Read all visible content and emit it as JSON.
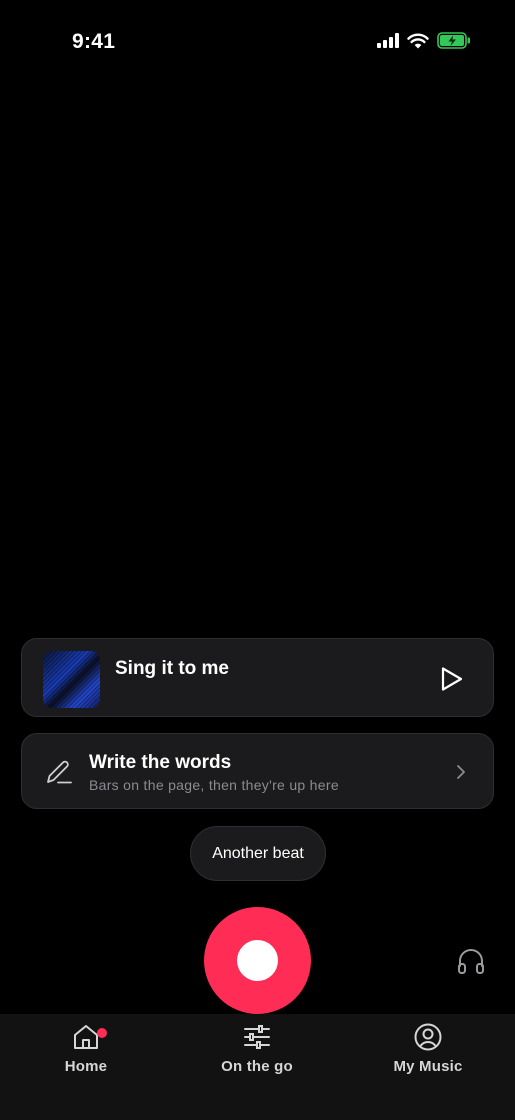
{
  "status_bar": {
    "time": "9:41"
  },
  "player": {
    "title": "Sing it to me",
    "art_icon": "album-art",
    "play_icon": "play-icon"
  },
  "lyrics": {
    "title": "Write the words",
    "subtitle": "Bars on the page, then they're up here",
    "icon": "pencil-icon"
  },
  "beat_button": {
    "label": "Another beat"
  },
  "record": {
    "icon": "record-icon",
    "accent": "#ff2d55"
  },
  "tabs": [
    {
      "label": "Home",
      "icon": "home-icon",
      "has_notification": true
    },
    {
      "label": "On the go",
      "icon": "sliders-icon",
      "has_notification": false
    },
    {
      "label": "My Music",
      "icon": "profile-icon",
      "has_notification": false
    }
  ],
  "colors": {
    "background": "#000000",
    "card": "#1b1b1d",
    "accent": "#ff2d55",
    "battery": "#34c759"
  }
}
